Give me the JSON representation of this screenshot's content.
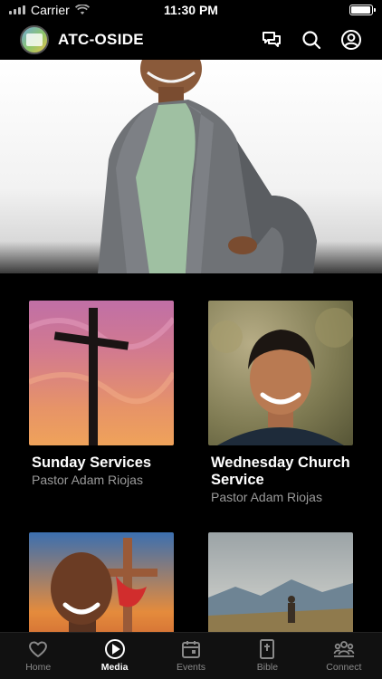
{
  "status_bar": {
    "carrier": "Carrier",
    "time": "11:30 PM",
    "battery_level": 0.95
  },
  "header": {
    "title": "ATC-OSIDE",
    "icons": [
      "logo-icon",
      "chat-icon",
      "search-icon",
      "profile-icon"
    ]
  },
  "hero": {
    "image": "pastor-portrait-photo"
  },
  "media_cards": [
    {
      "title": "Sunday Services",
      "subtitle": "Pastor Adam Riojas",
      "image": "cross-sunset-photo"
    },
    {
      "title": "Wednesday Church Service",
      "subtitle": "Pastor Adam Riojas",
      "image": "pastor-smiling-photo"
    },
    {
      "title": "",
      "subtitle": "",
      "image": "speaker-cross-painting-photo"
    },
    {
      "title": "",
      "subtitle": "",
      "image": "mountain-hiker-photo"
    }
  ],
  "tabs": [
    {
      "label": "Home",
      "icon": "heart-icon",
      "active": false
    },
    {
      "label": "Media",
      "icon": "play-circle-icon",
      "active": true
    },
    {
      "label": "Events",
      "icon": "calendar-icon",
      "active": false
    },
    {
      "label": "Bible",
      "icon": "bible-icon",
      "active": false
    },
    {
      "label": "Connect",
      "icon": "people-icon",
      "active": false
    }
  ],
  "colors": {
    "background": "#000000",
    "active_tab": "#ffffff",
    "inactive_tab": "#8a8a8a",
    "subtitle": "#9a9a9a"
  }
}
